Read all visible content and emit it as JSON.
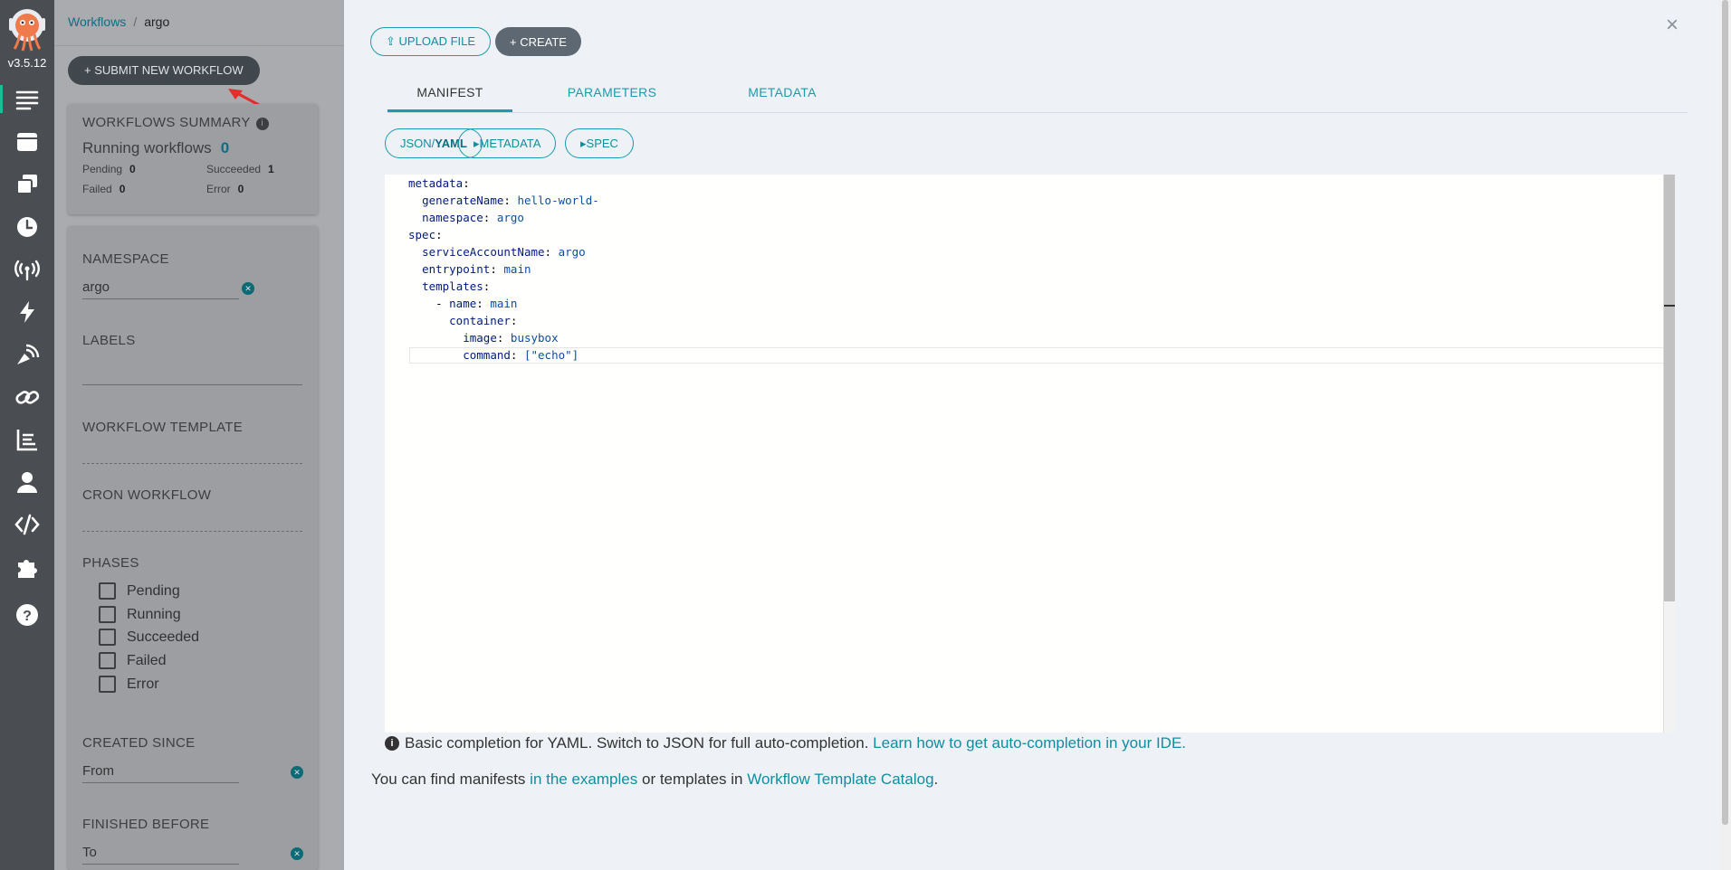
{
  "nav": {
    "version": "v3.5.12",
    "items": [
      {
        "icon": "workflows-list-icon"
      },
      {
        "icon": "workflow-templates-icon"
      },
      {
        "icon": "cluster-templates-icon"
      },
      {
        "icon": "cron-workflows-icon"
      },
      {
        "icon": "event-sources-icon"
      },
      {
        "icon": "sensors-icon"
      },
      {
        "icon": "event-flow-icon"
      },
      {
        "icon": "links-icon"
      },
      {
        "icon": "reports-icon"
      },
      {
        "icon": "user-icon"
      },
      {
        "icon": "api-docs-icon"
      },
      {
        "icon": "plugins-icon"
      },
      {
        "icon": "help-icon"
      }
    ]
  },
  "breadcrumb": {
    "root": "Workflows",
    "current": "argo"
  },
  "submit_button": "+ SUBMIT NEW WORKFLOW",
  "summary": {
    "title": "WORKFLOWS SUMMARY",
    "running_label": "Running workflows",
    "running_count": "0",
    "stats": [
      {
        "label": "Pending",
        "value": "0"
      },
      {
        "label": "Succeeded",
        "value": "1"
      },
      {
        "label": "Failed",
        "value": "0"
      },
      {
        "label": "Error",
        "value": "0"
      }
    ]
  },
  "filters": {
    "namespace_label": "NAMESPACE",
    "namespace_value": "argo",
    "labels_label": "LABELS",
    "workflow_template_label": "WORKFLOW TEMPLATE",
    "cron_workflow_label": "CRON WORKFLOW",
    "phases_label": "PHASES",
    "phases": [
      "Pending",
      "Running",
      "Succeeded",
      "Failed",
      "Error"
    ],
    "created_since_label": "CREATED SINCE",
    "created_since_placeholder": "From",
    "finished_before_label": "FINISHED BEFORE",
    "finished_before_placeholder": "To"
  },
  "drawer": {
    "upload_button": "UPLOAD FILE",
    "create_button": "+ CREATE",
    "close": "×",
    "tabs": [
      "MANIFEST",
      "PARAMETERS",
      "METADATA"
    ],
    "active_tab": "MANIFEST",
    "chips": {
      "json": "JSON/",
      "yaml": "YAML",
      "metadata": "METADATA",
      "spec": "SPEC"
    },
    "manifest_lines": [
      {
        "indent": "",
        "key": "metadata",
        "value": ""
      },
      {
        "indent": "  ",
        "key": "generateName",
        "value": "hello-world-"
      },
      {
        "indent": "  ",
        "key": "namespace",
        "value": "argo"
      },
      {
        "indent": "",
        "key": "spec",
        "value": ""
      },
      {
        "indent": "  ",
        "key": "serviceAccountName",
        "value": "argo"
      },
      {
        "indent": "  ",
        "key": "entrypoint",
        "value": "main"
      },
      {
        "indent": "  ",
        "key": "templates",
        "value": ""
      },
      {
        "indent": "    - ",
        "key": "name",
        "value": "main"
      },
      {
        "indent": "      ",
        "key": "container",
        "value": ""
      },
      {
        "indent": "        ",
        "key": "image",
        "value": "busybox"
      },
      {
        "indent": "        ",
        "key": "command",
        "value": "[\"echo\"]"
      }
    ],
    "hint_text": "Basic completion for YAML. Switch to JSON for full auto-completion.",
    "hint_link": "Learn how to get auto-completion in your IDE.",
    "find_prefix": "You can find manifests",
    "find_link1": "in the examples",
    "find_mid": "or templates in",
    "find_link2": "Workflow Template Catalog",
    "find_suffix": "."
  },
  "colors": {
    "accent": "#1c9bae",
    "nav_bg": "#4a4d52",
    "active_indicator": "#18be94"
  }
}
